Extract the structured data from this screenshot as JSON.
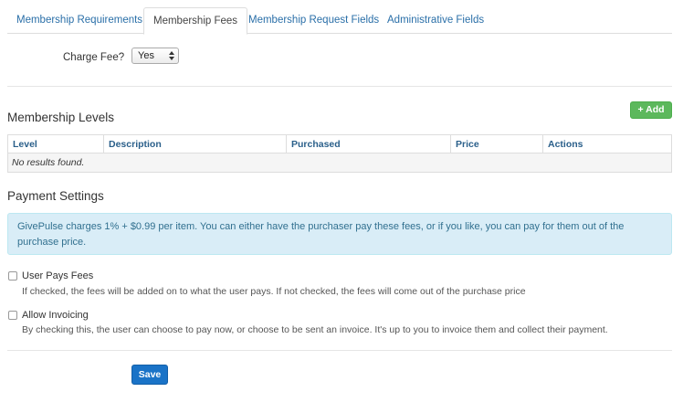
{
  "tabs": [
    {
      "label": "Membership Requirements",
      "active": false
    },
    {
      "label": "Membership Fees",
      "active": true
    },
    {
      "label": "Membership Request Fields",
      "active": false
    },
    {
      "label": "Administrative Fields",
      "active": false
    }
  ],
  "charge_fee": {
    "label": "Charge Fee?",
    "selected": "Yes"
  },
  "membership_levels": {
    "title": "Membership Levels",
    "add_label": "Add",
    "columns": [
      "Level",
      "Description",
      "Purchased",
      "Price",
      "Actions"
    ],
    "empty_text": "No results found."
  },
  "payment_settings": {
    "title": "Payment Settings",
    "info_text": "GivePulse charges 1% + $0.99 per item. You can either have the purchaser pay these fees, or if you like, you can pay for them out of the purchase price.",
    "user_pays_fees": {
      "label": "User Pays Fees",
      "help": "If checked, the fees will be added on to what the user pays. If not checked, the fees will come out of the purchase price",
      "checked": false
    },
    "allow_invoicing": {
      "label": "Allow Invoicing",
      "help": "By checking this, the user can choose to pay now, or choose to be sent an invoice. It's up to you to invoice them and collect their payment.",
      "checked": false
    }
  },
  "save_label": "Save",
  "colors": {
    "link": "#2a6fa8",
    "success": "#5cb85c",
    "primary": "#1a73c7",
    "info_bg": "#d9edf7"
  }
}
